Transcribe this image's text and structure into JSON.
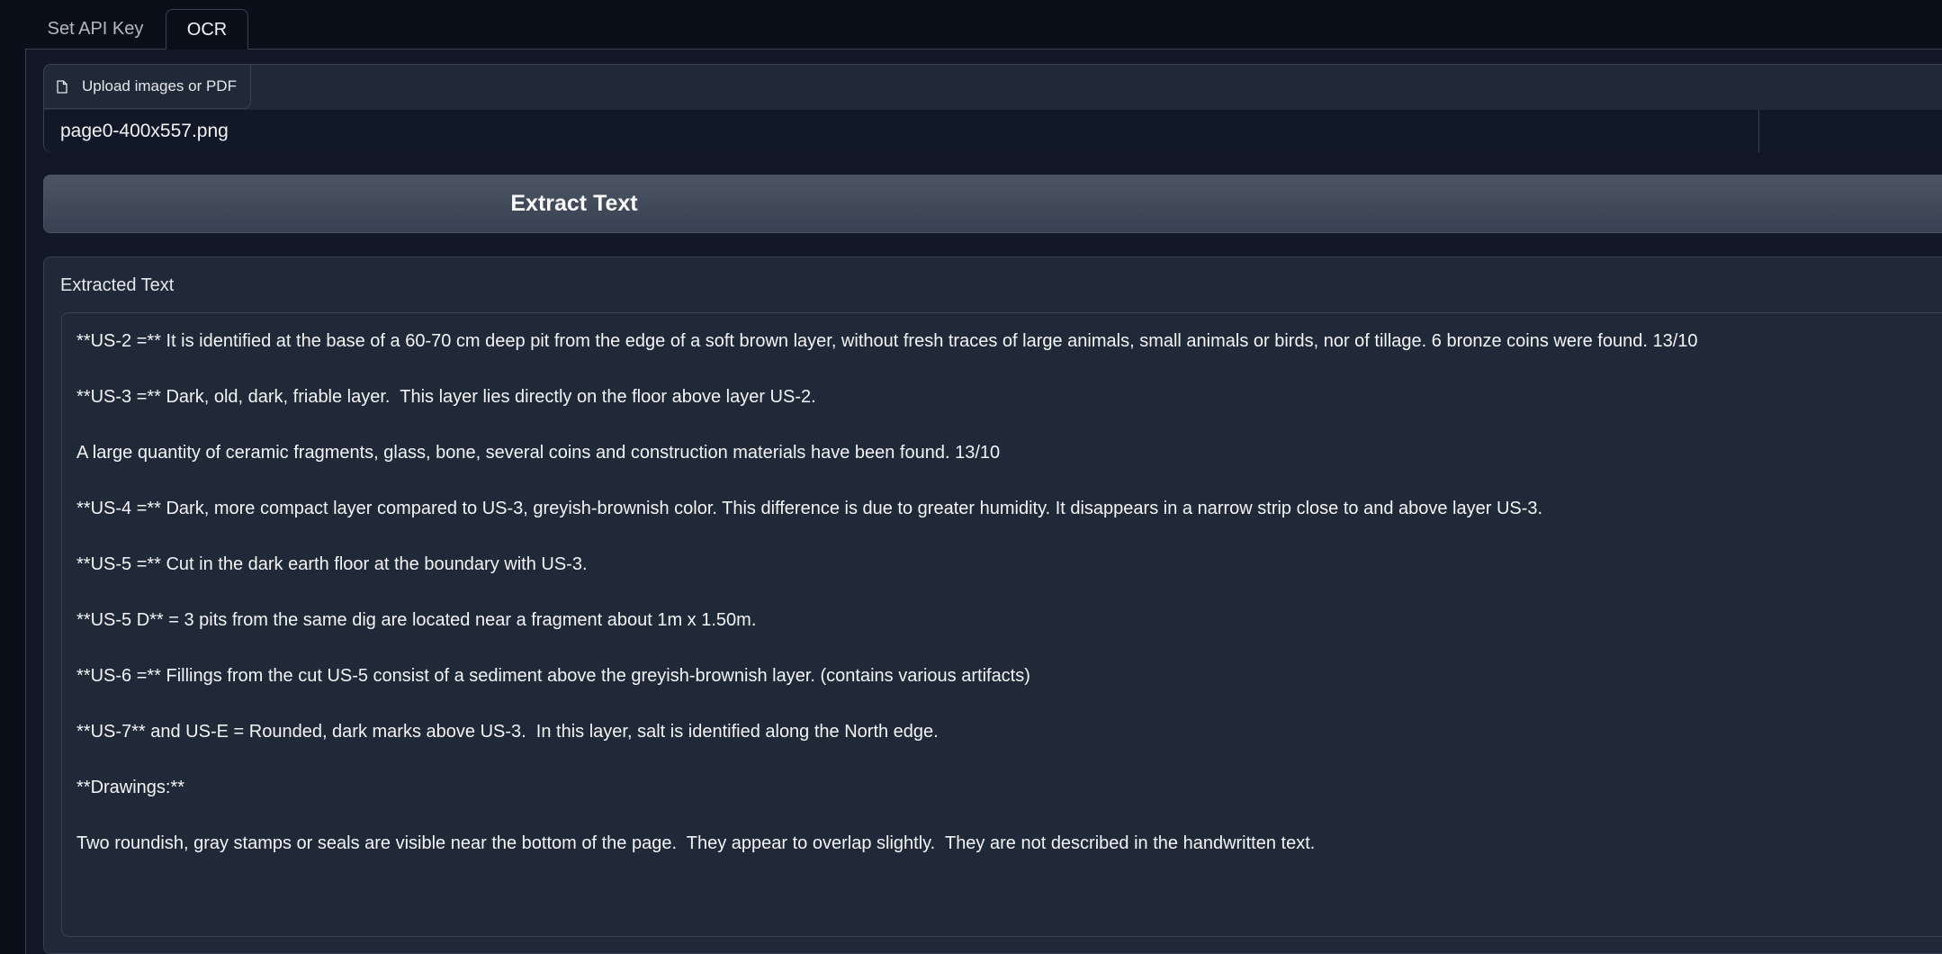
{
  "tabs": [
    {
      "label": "Set API Key",
      "active": false
    },
    {
      "label": "OCR",
      "active": true
    }
  ],
  "upload": {
    "button_label": "Upload images or PDF",
    "icon": "file-icon",
    "file_name": "page0-400x557.png"
  },
  "extract_button": {
    "label": "Extract Text"
  },
  "output": {
    "label": "Extracted Text",
    "paragraphs": [
      "**US-2 =** It is identified at the base of a 60-70 cm deep pit from the edge of a soft brown layer, without fresh traces of large animals, small animals or birds, nor of tillage. 6 bronze coins were found. 13/10",
      "**US-3 =** Dark, old, dark, friable layer.  This layer lies directly on the floor above layer US-2.",
      "A large quantity of ceramic fragments, glass, bone, several coins and construction materials have been found. 13/10",
      "**US-4 =** Dark, more compact layer compared to US-3, greyish-brownish color. This difference is due to greater humidity. It disappears in a narrow strip close to and above layer US-3.",
      "**US-5 =** Cut in the dark earth floor at the boundary with US-3.",
      "**US-5 D** = 3 pits from the same dig are located near a fragment about 1m x 1.50m.",
      "**US-6 =** Fillings from the cut US-5 consist of a sediment above the greyish-brownish layer. (contains various artifacts)",
      "**US-7** and US-E = Rounded, dark marks above US-3.  In this layer, salt is identified along the North edge.",
      "**Drawings:**",
      "Two roundish, gray stamps or seals are visible near the bottom of the page.  They appear to overlap slightly.  They are not described in the handwritten text."
    ]
  },
  "colors": {
    "background": "#0b0f19",
    "panel": "#1f2937",
    "border": "#374151",
    "button": "#4b5563",
    "text": "#f3f4f6"
  }
}
